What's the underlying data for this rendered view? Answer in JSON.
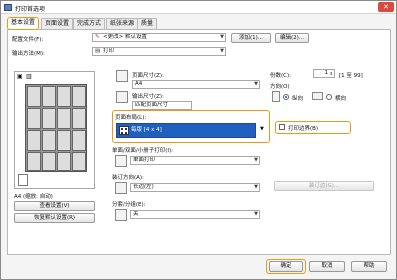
{
  "window": {
    "title": "打印首选项",
    "close_glyph": "✕"
  },
  "tabs": [
    "基本设置",
    "页面设置",
    "完成方式",
    "纸张来源",
    "质量"
  ],
  "top": {
    "profile_label": "配置文件(F):",
    "profile_value": "<更改> 默认设置",
    "add_button": "添加(1)...",
    "edit_button": "编辑(2)...",
    "output_label": "输出方法(M):",
    "output_value": "打印"
  },
  "preview": {
    "paper_caption": "A4 (缩放: 自动)",
    "view_settings_button": "查看设置(V)",
    "restore_defaults_button": "恢复默认设置(R)"
  },
  "page": {
    "page_size_label": "页面尺寸(Z):",
    "page_size_value": "A4",
    "output_size_label": "输出尺寸(Z):",
    "output_size_value": "匹配页面尺寸"
  },
  "copies": {
    "label": "份数(C):",
    "value": "1",
    "range": "[1 至 99]"
  },
  "orientation": {
    "label": "方向(O)",
    "portrait": "纵向",
    "landscape": "横向"
  },
  "layout": {
    "label": "页面布局(L):",
    "value": "每版 [4 x 4]",
    "print_border_label": "打印边界(B)"
  },
  "duplex": {
    "label": "单面/双面/小册子打印(I):",
    "value": "单面打印"
  },
  "binding": {
    "label": "装订方向(A):",
    "value": "长边(左)",
    "gutter_button": "装订边(G)..."
  },
  "collate": {
    "label": "分套/分组(E):",
    "value": "关"
  },
  "footer": {
    "ok_button": "确定",
    "cancel_button": "取消",
    "help_button": "帮助"
  },
  "colors": {
    "highlight": "#e99a1b",
    "selection": "#1f5fbf"
  }
}
